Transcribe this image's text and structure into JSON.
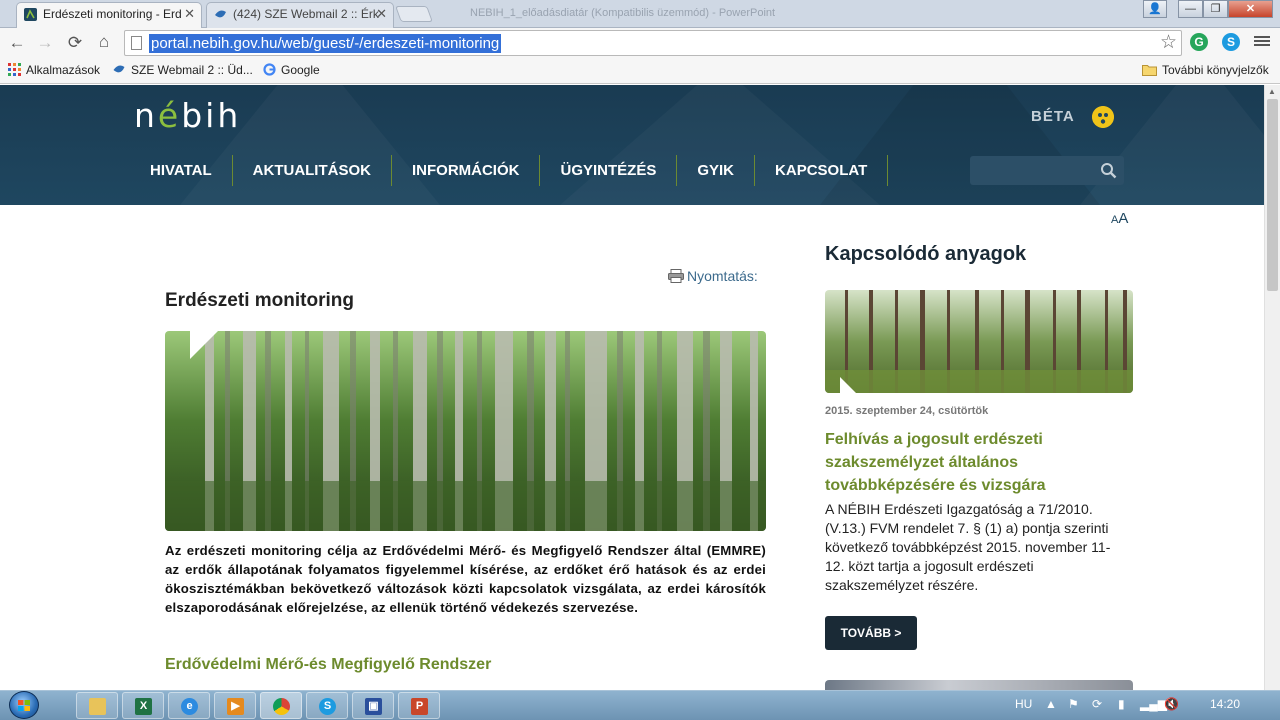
{
  "browser": {
    "tabs": [
      {
        "title": "Erdészeti monitoring - Erd",
        "active": true
      },
      {
        "title": "(424) SZE Webmail 2 :: Érk",
        "active": false
      }
    ],
    "window_title": "NEBIH_1_előadásdiatár (Kompatibilis üzemmód) - PowerPoint",
    "url": "portal.nebih.gov.hu/web/guest/-/erdeszeti-monitoring",
    "bookmarks": [
      {
        "label": "Alkalmazások",
        "icon": "apps-grid-icon"
      },
      {
        "label": "SZE Webmail 2 :: Üd...",
        "icon": "webmail-icon"
      },
      {
        "label": "Google",
        "icon": "google-icon"
      }
    ],
    "bookmarks_folder": "További könyvjelzők"
  },
  "site": {
    "logo": {
      "prefix": "n",
      "accent": "é",
      "rest": "bih"
    },
    "beta_label": "BÉTA",
    "nav": [
      "HIVATAL",
      "AKTUALITÁSOK",
      "INFORMÁCIÓK",
      "ÜGYINTÉZÉS",
      "GYIK",
      "KAPCSOLAT"
    ],
    "search_placeholder": "",
    "font_size_toggle": {
      "small": "A",
      "large": "A"
    },
    "colors": {
      "header": "#1f4760",
      "accent_green": "#6d8b2d",
      "button_dark": "#1a2a36"
    }
  },
  "article": {
    "print_label": "Nyomtatás:",
    "title": "Erdészeti monitoring",
    "intro": "Az erdészeti monitoring célja az Erdővédelmi Mérő- és Megfigyelő Rendszer által (EMMRE) az erdők állapotának folyamatos figyelemmel kísérése, az erdőket érő hatások és az erdei ökoszisztémákban bekövetkező változások közti kapcsolatok vizsgálata, az erdei károsítók elszaporodásának előrejelzése, az ellenük történő védekezés szervezése.",
    "subheading": "Erdővédelmi Mérő-és Megfigyelő Rendszer"
  },
  "aside": {
    "title": "Kapcsolódó anyagok",
    "item": {
      "date": "2015. szeptember 24, csütörtök",
      "title": "Felhívás a jogosult erdészeti szakszemélyzet általános továbbképzésére és vizsgára",
      "body": "A NÉBIH Erdészeti Igazgatóság a 71/2010. (V.13.) FVM rendelet 7. § (1) a) pontja szerinti következő továbbképzést 2015. november 11-12. közt tartja a jogosult erdészeti szakszemélyzet részére.",
      "button": "TOVÁBB >"
    }
  },
  "taskbar": {
    "apps": [
      "explorer-icon",
      "excel-icon",
      "ie-icon",
      "media-player-icon",
      "chrome-icon",
      "skype-icon",
      "save-icon",
      "powerpoint-icon"
    ],
    "language": "HU",
    "clock": "14:20"
  }
}
